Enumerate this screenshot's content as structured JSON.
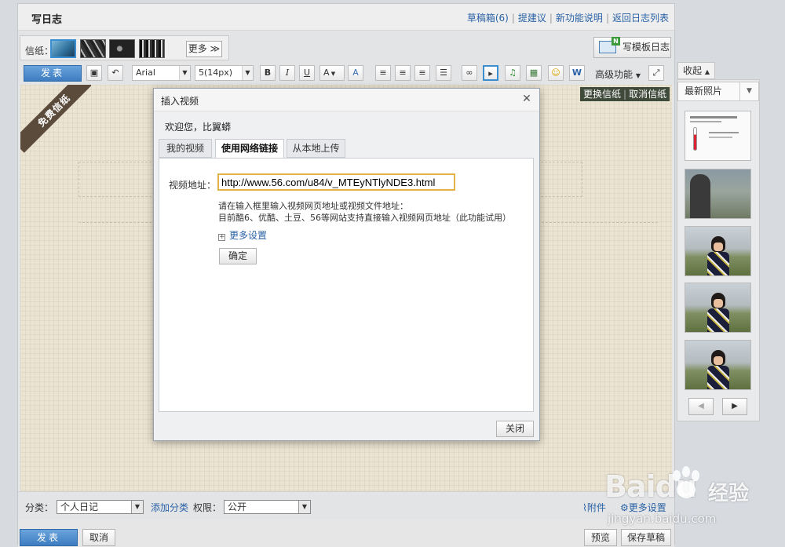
{
  "header": {
    "title": "写日志",
    "links": [
      "草稿箱(6)",
      "提建议",
      "新功能说明",
      "返回日志列表"
    ]
  },
  "paper": {
    "label": "信纸：",
    "more": "更多 ≫",
    "template_button": "写模板日志",
    "ribbon": "免费信纸",
    "change": "更换信纸",
    "cancel": "取消信纸"
  },
  "toolbar": {
    "publish": "发表",
    "font": "Arial",
    "size": "5(14px)",
    "advanced": "高级功能",
    "icons": [
      "save-icon",
      "undo-icon",
      "bold-icon",
      "italic-icon",
      "underline-icon",
      "font-color-icon",
      "highlight-icon",
      "align-left-icon",
      "align-center-icon",
      "align-right-icon",
      "justify-icon",
      "link-icon",
      "video-icon",
      "music-icon",
      "image-icon",
      "emoji-icon",
      "word-icon",
      "expand-icon"
    ]
  },
  "dialog": {
    "title": "插入视频",
    "welcome": "欢迎您，比翼蟒",
    "tabs": [
      "我的视频",
      "使用网络链接",
      "从本地上传"
    ],
    "active_tab": 1,
    "url_label": "视频地址：",
    "url_value": "http://www.56.com/u84/v_MTEyNTlyNDE3.html",
    "help_line1": "请在输入框里输入视频网页地址或视频文件地址：",
    "help_line2": "目前酷6、优酷、土豆、56等网站支持直接输入视频网页地址（此功能试用）",
    "more_settings": "更多设置",
    "confirm": "确定",
    "close": "关闭"
  },
  "bottom": {
    "category_label": "分类：",
    "category_value": "个人日记",
    "add_category": "添加分类",
    "permission_label": "权限：",
    "permission_value": "公开",
    "attachment": "附件",
    "more_settings": "更多设置",
    "publish": "发表",
    "cancel": "取消",
    "preview": "预览",
    "save_draft": "保存草稿"
  },
  "side": {
    "collapse": "收起",
    "recent_photos": "最新照片"
  },
  "watermark": {
    "brand": "Baidu",
    "cn": "经验",
    "url": "jingyan.baidu.com"
  }
}
